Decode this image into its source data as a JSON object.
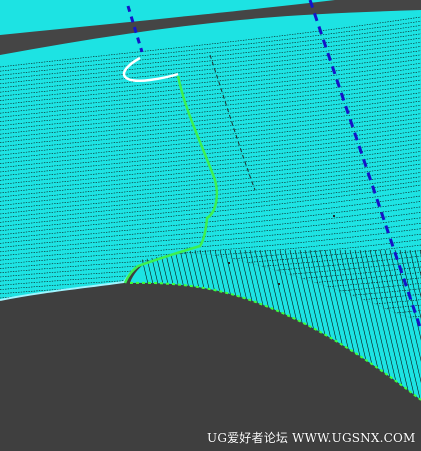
{
  "viewport": {
    "name": "cad-3d-viewport",
    "background_color": "#3f3f3f",
    "colors": {
      "surface": "#1de3e3",
      "toolpath_line": "#000000",
      "dashed_axis": "#1414c8",
      "selected_curve": "#3cf050",
      "edge_highlight": "#9ff5ff",
      "white_curve": "#ffffff",
      "boundary_green": "#3cff3c"
    },
    "icons": {
      "dashed-axis-left": "dashed-line-icon",
      "dashed-axis-right": "dashed-line-icon"
    }
  },
  "watermark": {
    "text": "UG爱好者论坛 WWW.UGSNX.COM"
  }
}
